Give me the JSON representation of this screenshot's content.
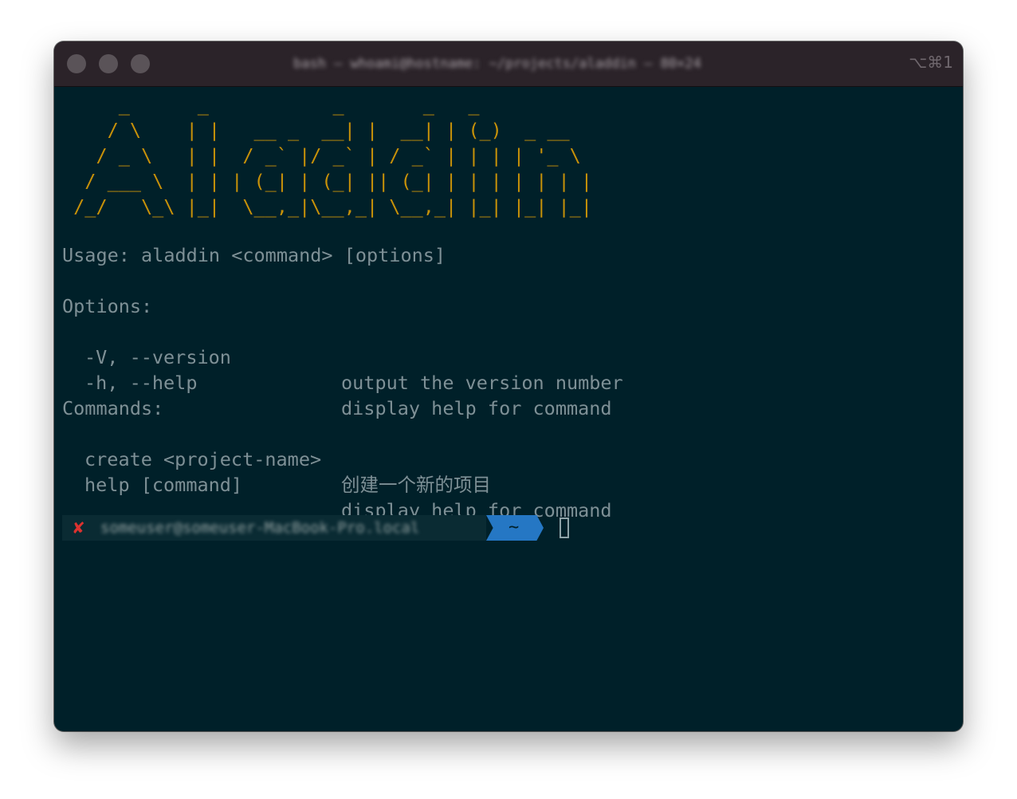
{
  "window": {
    "title": "bash — whoami@hostname: ~/projects/aladdin — 80×24",
    "shortcut": "⌥⌘1"
  },
  "terminal": {
    "banner": "     _      _           _       _   _\n    / \\    | |   __ _  __| |  __| | (_)  _ __\n   / _ \\   | |  / _` |/ _` | / _` | | | | '_ \\\n  / ___ \\  | | | (_| | (_| || (_| | | | | | | |\n /_/   \\_\\ |_|  \\__,_|\\__,_| \\__,_| |_| |_| |_|",
    "usage": "Usage: aladdin <command> [options]",
    "options_header": "Options:",
    "options": [
      {
        "flag": "-V, --version",
        "desc": "output the version number"
      },
      {
        "flag": "-h, --help",
        "desc": "display help for command"
      }
    ],
    "commands_header": "Commands:",
    "commands": [
      {
        "name": "create <project-name>",
        "desc": "创建一个新的项目"
      },
      {
        "name": "help [command]",
        "desc": "display help for command"
      }
    ],
    "prompt": {
      "status_icon": "✘",
      "user_host": "someuser@someuser-MacBook-Pro.local",
      "cwd": "~"
    }
  },
  "colors": {
    "background": "#002029",
    "text": "#7e9096",
    "banner": "#c89209",
    "error": "#dc322f",
    "cwd_segment": "#2577c4"
  }
}
